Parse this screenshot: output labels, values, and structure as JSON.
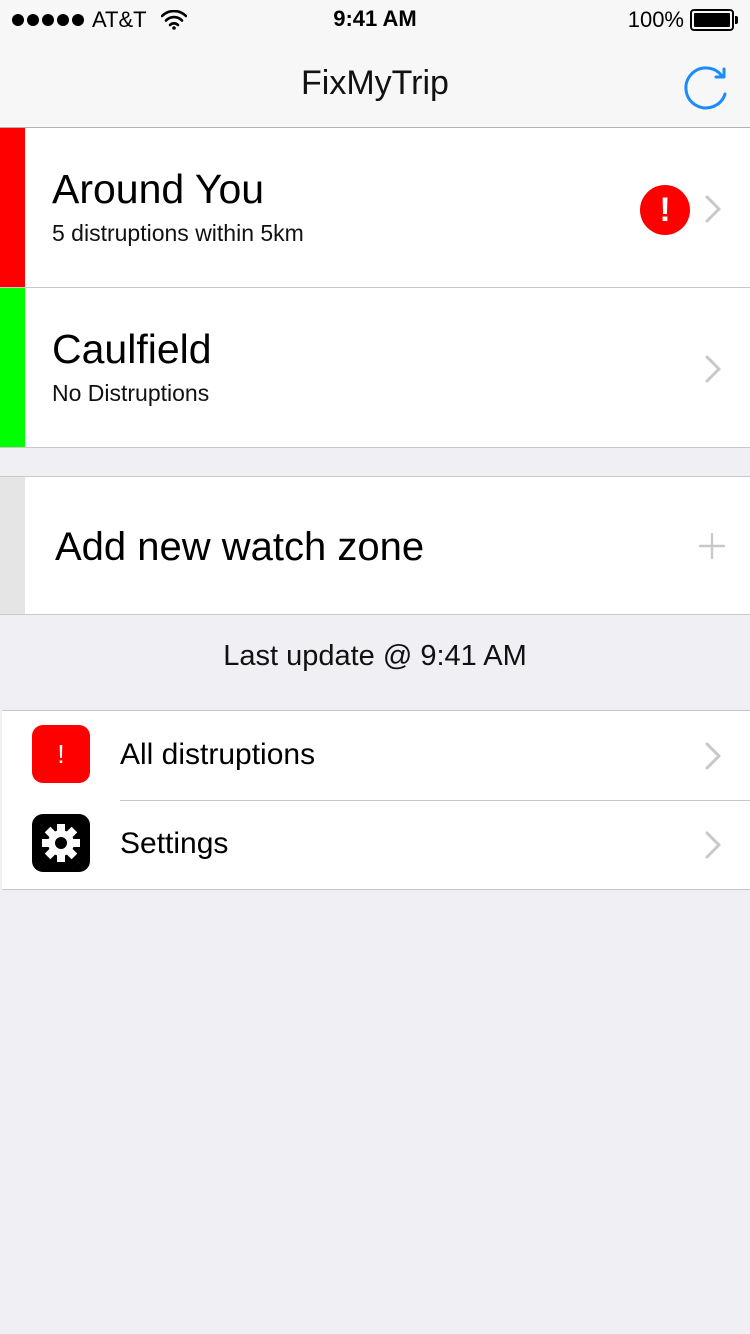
{
  "status_bar": {
    "carrier": "AT&T",
    "time": "9:41 AM",
    "battery": "100%"
  },
  "nav": {
    "title": "FixMyTrip",
    "refresh_icon": "refresh-icon"
  },
  "zones": [
    {
      "title": "Around You",
      "subtitle": "5 distruptions within 5km",
      "status_color": "#ff0000",
      "alert": "!"
    },
    {
      "title": "Caulfield",
      "subtitle": "No Distruptions",
      "status_color": "#00ff00"
    }
  ],
  "add_zone": {
    "label": "Add new watch zone"
  },
  "last_update": "Last update @ 9:41 AM",
  "menu": [
    {
      "label": "All distruptions",
      "icon": "alert-icon",
      "icon_text": "!"
    },
    {
      "label": "Settings",
      "icon": "gear-icon"
    }
  ],
  "colors": {
    "accent": "#1a8cff",
    "alert": "#ff0000",
    "ok": "#00ff00"
  }
}
